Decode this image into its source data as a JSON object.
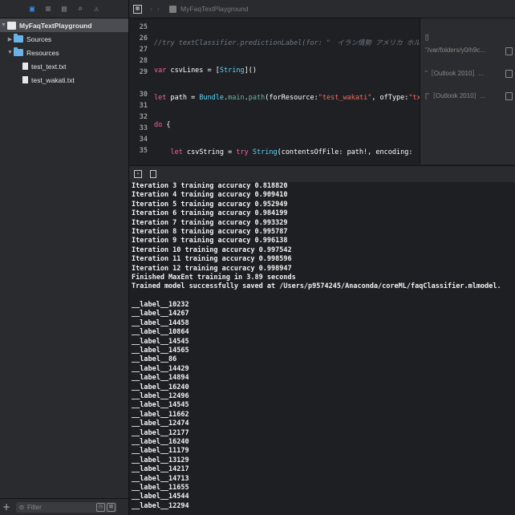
{
  "sidebar": {
    "toolbar_icons": [
      "folder-icon",
      "source-control-icon",
      "symbol-icon",
      "search-icon",
      "issue-icon"
    ],
    "project": "MyFaqTextPlayground",
    "items": [
      {
        "label": "Sources",
        "type": "folder",
        "expanded": false
      },
      {
        "label": "Resources",
        "type": "folder",
        "expanded": true
      },
      {
        "label": "test_text.txt",
        "type": "file"
      },
      {
        "label": "test_wakati.txt",
        "type": "file"
      }
    ],
    "filter_placeholder": "Filter",
    "add_label": "+"
  },
  "editor": {
    "breadcrumb": "MyFaqTextPlayground",
    "line_numbers": [
      "25",
      "26",
      "27",
      "28",
      "29",
      "",
      "30",
      "31",
      "32",
      "33",
      "34",
      "35",
      ""
    ],
    "results": {
      "r1": "[]",
      "r2": "\"/var/folders/y0/h9c...",
      "r3": "\"［Outlook 2010］...",
      "r4": "[\"［Outlook 2010］..."
    }
  },
  "console": {
    "lines": [
      "Iteration 3 training accuracy 0.818820",
      "Iteration 4 training accuracy 0.909410",
      "Iteration 5 training accuracy 0.952949",
      "Iteration 6 training accuracy 0.984199",
      "Iteration 7 training accuracy 0.993329",
      "Iteration 8 training accuracy 0.995787",
      "Iteration 9 training accuracy 0.996138",
      "Iteration 10 training accuracy 0.997542",
      "Iteration 11 training accuracy 0.998596",
      "Iteration 12 training accuracy 0.998947",
      "Finished MaxEnt training in 3.89 seconds",
      "Trained model successfully saved at /Users/p9574245/Anaconda/coreML/faqClassifier.mlmodel.",
      "",
      "__label__10232",
      "__label__14267",
      "__label__14458",
      "__label__10864",
      "__label__14545",
      "__label__14565",
      "__label__86",
      "__label__14429",
      "__label__14894",
      "__label__16240",
      "__label__12496",
      "__label__14545",
      "__label__11662",
      "__label__12474",
      "__label__12177",
      "__label__16240",
      "__label__11179",
      "__label__13129",
      "__label__14217",
      "__label__14713",
      "__label__11655",
      "__label__14544",
      "__label__12294"
    ]
  },
  "colors": {
    "keyword": "#fc5fa3",
    "string": "#fc6a5d",
    "comment": "#6c7986",
    "type": "#5dd8ff",
    "function": "#67b7a4",
    "selection": "#4a4c51",
    "folder": "#69b3ea"
  }
}
